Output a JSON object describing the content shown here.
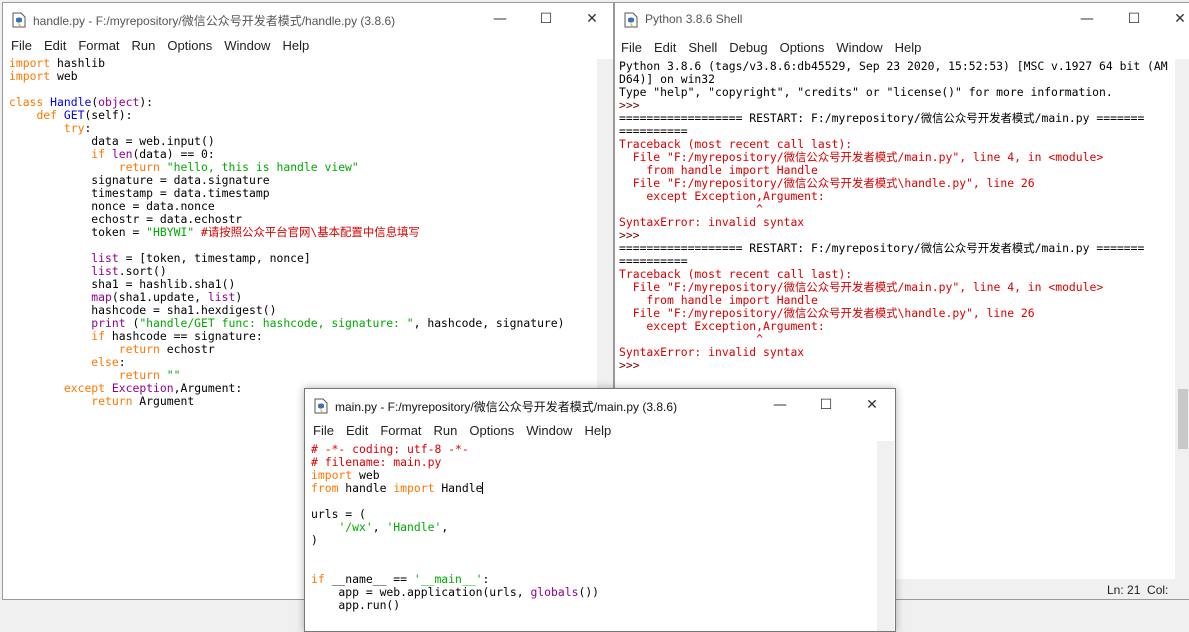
{
  "editor1": {
    "title": "handle.py - F:/myrepository/微信公众号开发者模式/handle.py (3.8.6)",
    "menu": [
      "File",
      "Edit",
      "Format",
      "Run",
      "Options",
      "Window",
      "Help"
    ],
    "code": [
      [
        {
          "t": "import",
          "c": "kw"
        },
        {
          "t": " hashlib"
        }
      ],
      [
        {
          "t": "import",
          "c": "kw"
        },
        {
          "t": " web"
        }
      ],
      [],
      [
        {
          "t": "class",
          "c": "kw"
        },
        {
          "t": " "
        },
        {
          "t": "Handle",
          "c": "df"
        },
        {
          "t": "("
        },
        {
          "t": "object",
          "c": "bi"
        },
        {
          "t": "):"
        }
      ],
      [
        {
          "t": "    "
        },
        {
          "t": "def",
          "c": "kw"
        },
        {
          "t": " "
        },
        {
          "t": "GET",
          "c": "df"
        },
        {
          "t": "(self):"
        }
      ],
      [
        {
          "t": "        "
        },
        {
          "t": "try",
          "c": "kw"
        },
        {
          "t": ":"
        }
      ],
      [
        {
          "t": "            data = web.input()"
        }
      ],
      [
        {
          "t": "            "
        },
        {
          "t": "if",
          "c": "kw"
        },
        {
          "t": " "
        },
        {
          "t": "len",
          "c": "bi"
        },
        {
          "t": "(data) == 0:"
        }
      ],
      [
        {
          "t": "                "
        },
        {
          "t": "return",
          "c": "kw"
        },
        {
          "t": " "
        },
        {
          "t": "\"hello, this is handle view\"",
          "c": "st"
        }
      ],
      [
        {
          "t": "            signature = data.signature"
        }
      ],
      [
        {
          "t": "            timestamp = data.timestamp"
        }
      ],
      [
        {
          "t": "            nonce = data.nonce"
        }
      ],
      [
        {
          "t": "            echostr = data.echostr"
        }
      ],
      [
        {
          "t": "            token = "
        },
        {
          "t": "\"HBYWI\"",
          "c": "st"
        },
        {
          "t": " "
        },
        {
          "t": "#请按照公众平台官网\\基本配置中信息填写",
          "c": "cm"
        }
      ],
      [],
      [
        {
          "t": "            "
        },
        {
          "t": "list",
          "c": "bi"
        },
        {
          "t": " = [token, timestamp, nonce]"
        }
      ],
      [
        {
          "t": "            "
        },
        {
          "t": "list",
          "c": "bi"
        },
        {
          "t": ".sort()"
        }
      ],
      [
        {
          "t": "            sha1 = hashlib.sha1()"
        }
      ],
      [
        {
          "t": "            "
        },
        {
          "t": "map",
          "c": "bi"
        },
        {
          "t": "(sha1.update, "
        },
        {
          "t": "list",
          "c": "bi"
        },
        {
          "t": ")"
        }
      ],
      [
        {
          "t": "            hashcode = sha1.hexdigest()"
        }
      ],
      [
        {
          "t": "            "
        },
        {
          "t": "print",
          "c": "bi"
        },
        {
          "t": " ("
        },
        {
          "t": "\"handle/GET func: hashcode, signature: \"",
          "c": "st"
        },
        {
          "t": ", hashcode, signature)"
        }
      ],
      [
        {
          "t": "            "
        },
        {
          "t": "if",
          "c": "kw"
        },
        {
          "t": " hashcode == signature:"
        }
      ],
      [
        {
          "t": "                "
        },
        {
          "t": "return",
          "c": "kw"
        },
        {
          "t": " echostr"
        }
      ],
      [
        {
          "t": "            "
        },
        {
          "t": "else",
          "c": "kw"
        },
        {
          "t": ":"
        }
      ],
      [
        {
          "t": "                "
        },
        {
          "t": "return",
          "c": "kw"
        },
        {
          "t": " "
        },
        {
          "t": "\"\"",
          "c": "st"
        }
      ],
      [
        {
          "t": "        "
        },
        {
          "t": "except",
          "c": "kw"
        },
        {
          "t": " "
        },
        {
          "t": "Exception",
          "c": "bi"
        },
        {
          "t": ",Argument:"
        }
      ],
      [
        {
          "t": "            "
        },
        {
          "t": "return",
          "c": "kw"
        },
        {
          "t": " Argument"
        }
      ]
    ]
  },
  "shell": {
    "title": "Python 3.8.6 Shell",
    "menu": [
      "File",
      "Edit",
      "Shell",
      "Debug",
      "Options",
      "Window",
      "Help"
    ],
    "code": [
      [
        {
          "t": "Python 3.8.6 (tags/v3.8.6:db45529, Sep 23 2020, 15:52:53) [MSC v.1927 64 bit (AM",
          "c": "out"
        }
      ],
      [
        {
          "t": "D64)] on win32",
          "c": "out"
        }
      ],
      [
        {
          "t": "Type \"help\", \"copyright\", \"credits\" or \"license()\" for more information.",
          "c": "out"
        }
      ],
      [
        {
          "t": ">>> ",
          "c": "prompt"
        }
      ],
      [
        {
          "t": "================== RESTART: F:/myrepository/微信公众号开发者模式/main.py =======",
          "c": "out"
        }
      ],
      [
        {
          "t": "==========",
          "c": "out"
        }
      ],
      [
        {
          "t": "Traceback (most recent call last):",
          "c": "err"
        }
      ],
      [
        {
          "t": "  File \"F:/myrepository/微信公众号开发者模式/main.py\", line 4, in <module>",
          "c": "err"
        }
      ],
      [
        {
          "t": "    from handle import Handle",
          "c": "err"
        }
      ],
      [
        {
          "t": "  File \"F:/myrepository/微信公众号开发者模式\\handle.py\", line 26",
          "c": "err"
        }
      ],
      [
        {
          "t": "    except Exception,Argument:",
          "c": "err"
        }
      ],
      [
        {
          "t": "                    ^",
          "c": "err"
        }
      ],
      [
        {
          "t": "SyntaxError: invalid syntax",
          "c": "err"
        }
      ],
      [
        {
          "t": ">>> ",
          "c": "prompt"
        }
      ],
      [
        {
          "t": "================== RESTART: F:/myrepository/微信公众号开发者模式/main.py =======",
          "c": "out"
        }
      ],
      [
        {
          "t": "==========",
          "c": "out"
        }
      ],
      [
        {
          "t": "Traceback (most recent call last):",
          "c": "err"
        }
      ],
      [
        {
          "t": "  File \"F:/myrepository/微信公众号开发者模式/main.py\", line 4, in <module>",
          "c": "err"
        }
      ],
      [
        {
          "t": "    from handle import Handle",
          "c": "err"
        }
      ],
      [
        {
          "t": "  File \"F:/myrepository/微信公众号开发者模式\\handle.py\", line 26",
          "c": "err"
        }
      ],
      [
        {
          "t": "    except Exception,Argument:",
          "c": "err"
        }
      ],
      [
        {
          "t": "                    ^",
          "c": "err"
        }
      ],
      [
        {
          "t": "SyntaxError: invalid syntax",
          "c": "err"
        }
      ],
      [
        {
          "t": ">>> ",
          "c": "prompt"
        }
      ]
    ],
    "status": "Ln: 21  Col:"
  },
  "editor2": {
    "title": "main.py - F:/myrepository/微信公众号开发者模式/main.py (3.8.6)",
    "menu": [
      "File",
      "Edit",
      "Format",
      "Run",
      "Options",
      "Window",
      "Help"
    ],
    "code": [
      [
        {
          "t": "# -*- coding: utf-8 -*-",
          "c": "cm"
        }
      ],
      [
        {
          "t": "# filename: main.py",
          "c": "cm"
        }
      ],
      [
        {
          "t": "import",
          "c": "kw"
        },
        {
          "t": " web"
        }
      ],
      [
        {
          "t": "from",
          "c": "kw"
        },
        {
          "t": " handle "
        },
        {
          "t": "import",
          "c": "kw"
        },
        {
          "t": " Handle"
        }
      ],
      [],
      [
        {
          "t": "urls = ("
        }
      ],
      [
        {
          "t": "    "
        },
        {
          "t": "'/wx'",
          "c": "st"
        },
        {
          "t": ", "
        },
        {
          "t": "'Handle'",
          "c": "st"
        },
        {
          "t": ","
        }
      ],
      [
        {
          "t": ")"
        }
      ],
      [],
      [],
      [
        {
          "t": "if",
          "c": "kw"
        },
        {
          "t": " __name__ == "
        },
        {
          "t": "'__main__'",
          "c": "st"
        },
        {
          "t": ":"
        }
      ],
      [
        {
          "t": "    app = web.application(urls, "
        },
        {
          "t": "globals",
          "c": "bi"
        },
        {
          "t": "())"
        }
      ],
      [
        {
          "t": "    app.run()"
        }
      ]
    ]
  },
  "icons": {
    "minimize": "—",
    "maximize": "☐",
    "close": "✕"
  }
}
